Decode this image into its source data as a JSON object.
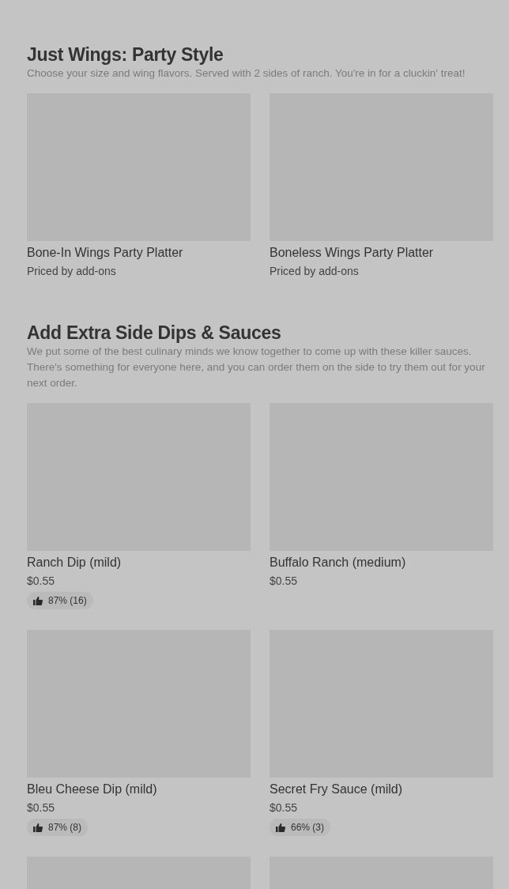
{
  "sections": [
    {
      "title": "Just Wings: Party Style",
      "description": "Choose your size and wing flavors. Served with 2 sides of ranch. You're in for a cluckin' treat!",
      "items": [
        {
          "kind": "picture",
          "name": "Bone-In Wings Party Platter",
          "price": "Priced by add-ons"
        },
        {
          "kind": "picture",
          "name": "Boneless Wings Party Platter",
          "price": "Priced by add-ons"
        }
      ]
    },
    {
      "title": "Add Extra Side Dips & Sauces",
      "description": "We put some of the best culinary minds we know together to come up with these killer sauces. There's something for everyone here, and you can order them on the side to try them out for your next order.",
      "items": [
        {
          "kind": "picture",
          "name": "Ranch Dip (mild)",
          "price": "$0.55",
          "rating": "87% (16)"
        },
        {
          "kind": "picture",
          "name": "Buffalo Ranch (medium)",
          "price": "$0.55"
        },
        {
          "kind": "picture",
          "name": "Bleu Cheese Dip (mild)",
          "price": "$0.55",
          "rating": "87% (8)"
        },
        {
          "kind": "picture",
          "name": "Secret Fry Sauce (mild)",
          "price": "$0.55",
          "rating": "66% (3)"
        },
        {
          "kind": "picture"
        },
        {
          "kind": "picture"
        }
      ]
    }
  ]
}
